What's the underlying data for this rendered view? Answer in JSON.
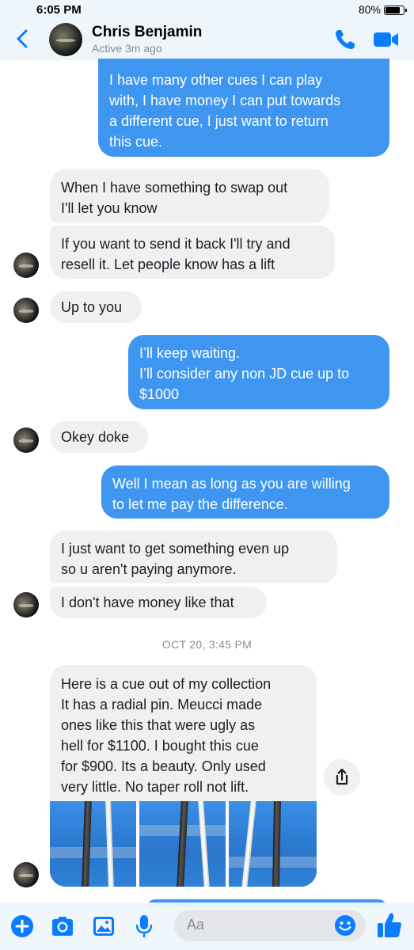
{
  "status_bar": {
    "time": "6:05 PM",
    "battery_percent": "80%",
    "battery_level": 0.8
  },
  "header": {
    "contact_name": "Chris Benjamin",
    "active_status": "Active 3m ago",
    "icons": [
      "back-chevron-icon",
      "phone-icon",
      "video-camera-icon"
    ]
  },
  "colors": {
    "outgoing_bubble": "#3f96f0",
    "incoming_bubble": "#eff0f2",
    "accent": "#0a7cff",
    "header_bg": "#eef6fc"
  },
  "messages": [
    {
      "direction": "out",
      "lines": [
        "I have many other cues I can play",
        "with, I have money I can put towards",
        "a different cue, I just want to return",
        "this cue."
      ]
    },
    {
      "direction": "in",
      "lines": [
        "When I have something to swap out",
        "I'll let you know"
      ]
    },
    {
      "direction": "in",
      "lines": [
        "If you want to send it back I'll try and",
        "resell it.  Let people know has a lift"
      ]
    },
    {
      "direction": "in",
      "lines": [
        "Up to you"
      ]
    },
    {
      "direction": "out",
      "lines": [
        "I’ll keep waiting.",
        "I’ll consider any non JD cue up to",
        "$1000"
      ]
    },
    {
      "direction": "in",
      "lines": [
        "Okey doke"
      ]
    },
    {
      "direction": "out",
      "lines": [
        "Well I mean as long as you are willing",
        "to let me pay the difference."
      ]
    },
    {
      "direction": "in",
      "lines": [
        "I just want to get something  even up",
        "so u aren't paying anymore."
      ]
    },
    {
      "direction": "in",
      "lines": [
        "I don't have money like that"
      ]
    },
    {
      "direction": "in",
      "lines": [
        "Here is a cue out of my collection",
        "It has a radial pin. Meucci made",
        "ones like this that were ugly as",
        "hell for $1100. I bought this cue",
        "for $900. Its a beauty. Only used",
        "very little. No taper roll not lift."
      ]
    }
  ],
  "timestamp": "OCT 20, 3:45 PM",
  "attachments": {
    "photo_count": 3,
    "photo_subject": "pool cue photos on blue background"
  },
  "composer": {
    "placeholder": "Aa",
    "icons": [
      "plus-icon",
      "camera-icon",
      "photo-gallery-icon",
      "microphone-icon",
      "emoji-icon",
      "thumbs-up-icon"
    ]
  }
}
